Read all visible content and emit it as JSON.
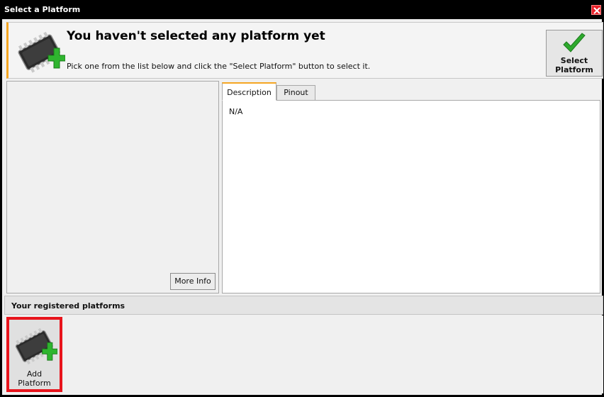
{
  "window": {
    "title": "Select a Platform"
  },
  "header": {
    "title": "You haven't selected any platform yet",
    "subtitle": "Pick one from the list below and click the \"Select Platform\" button to select it.",
    "select_button_label": "Select\nPlatform"
  },
  "left_panel": {
    "more_info_label": "More Info"
  },
  "tabs": [
    {
      "label": "Description",
      "active": true
    },
    {
      "label": "Pinout",
      "active": false
    }
  ],
  "description": {
    "text": "N/A"
  },
  "platforms_section": {
    "title": "Your registered platforms",
    "add_platform_label": "Add\nPlatform"
  },
  "colors": {
    "accent": "#f5a623",
    "close": "#e8212a",
    "highlight": "#e8141c",
    "check": "#2eaa2e",
    "plus": "#2fb52f"
  },
  "icons": {
    "close": "close-icon",
    "chip": "chip-add-icon",
    "check": "checkmark-icon"
  }
}
